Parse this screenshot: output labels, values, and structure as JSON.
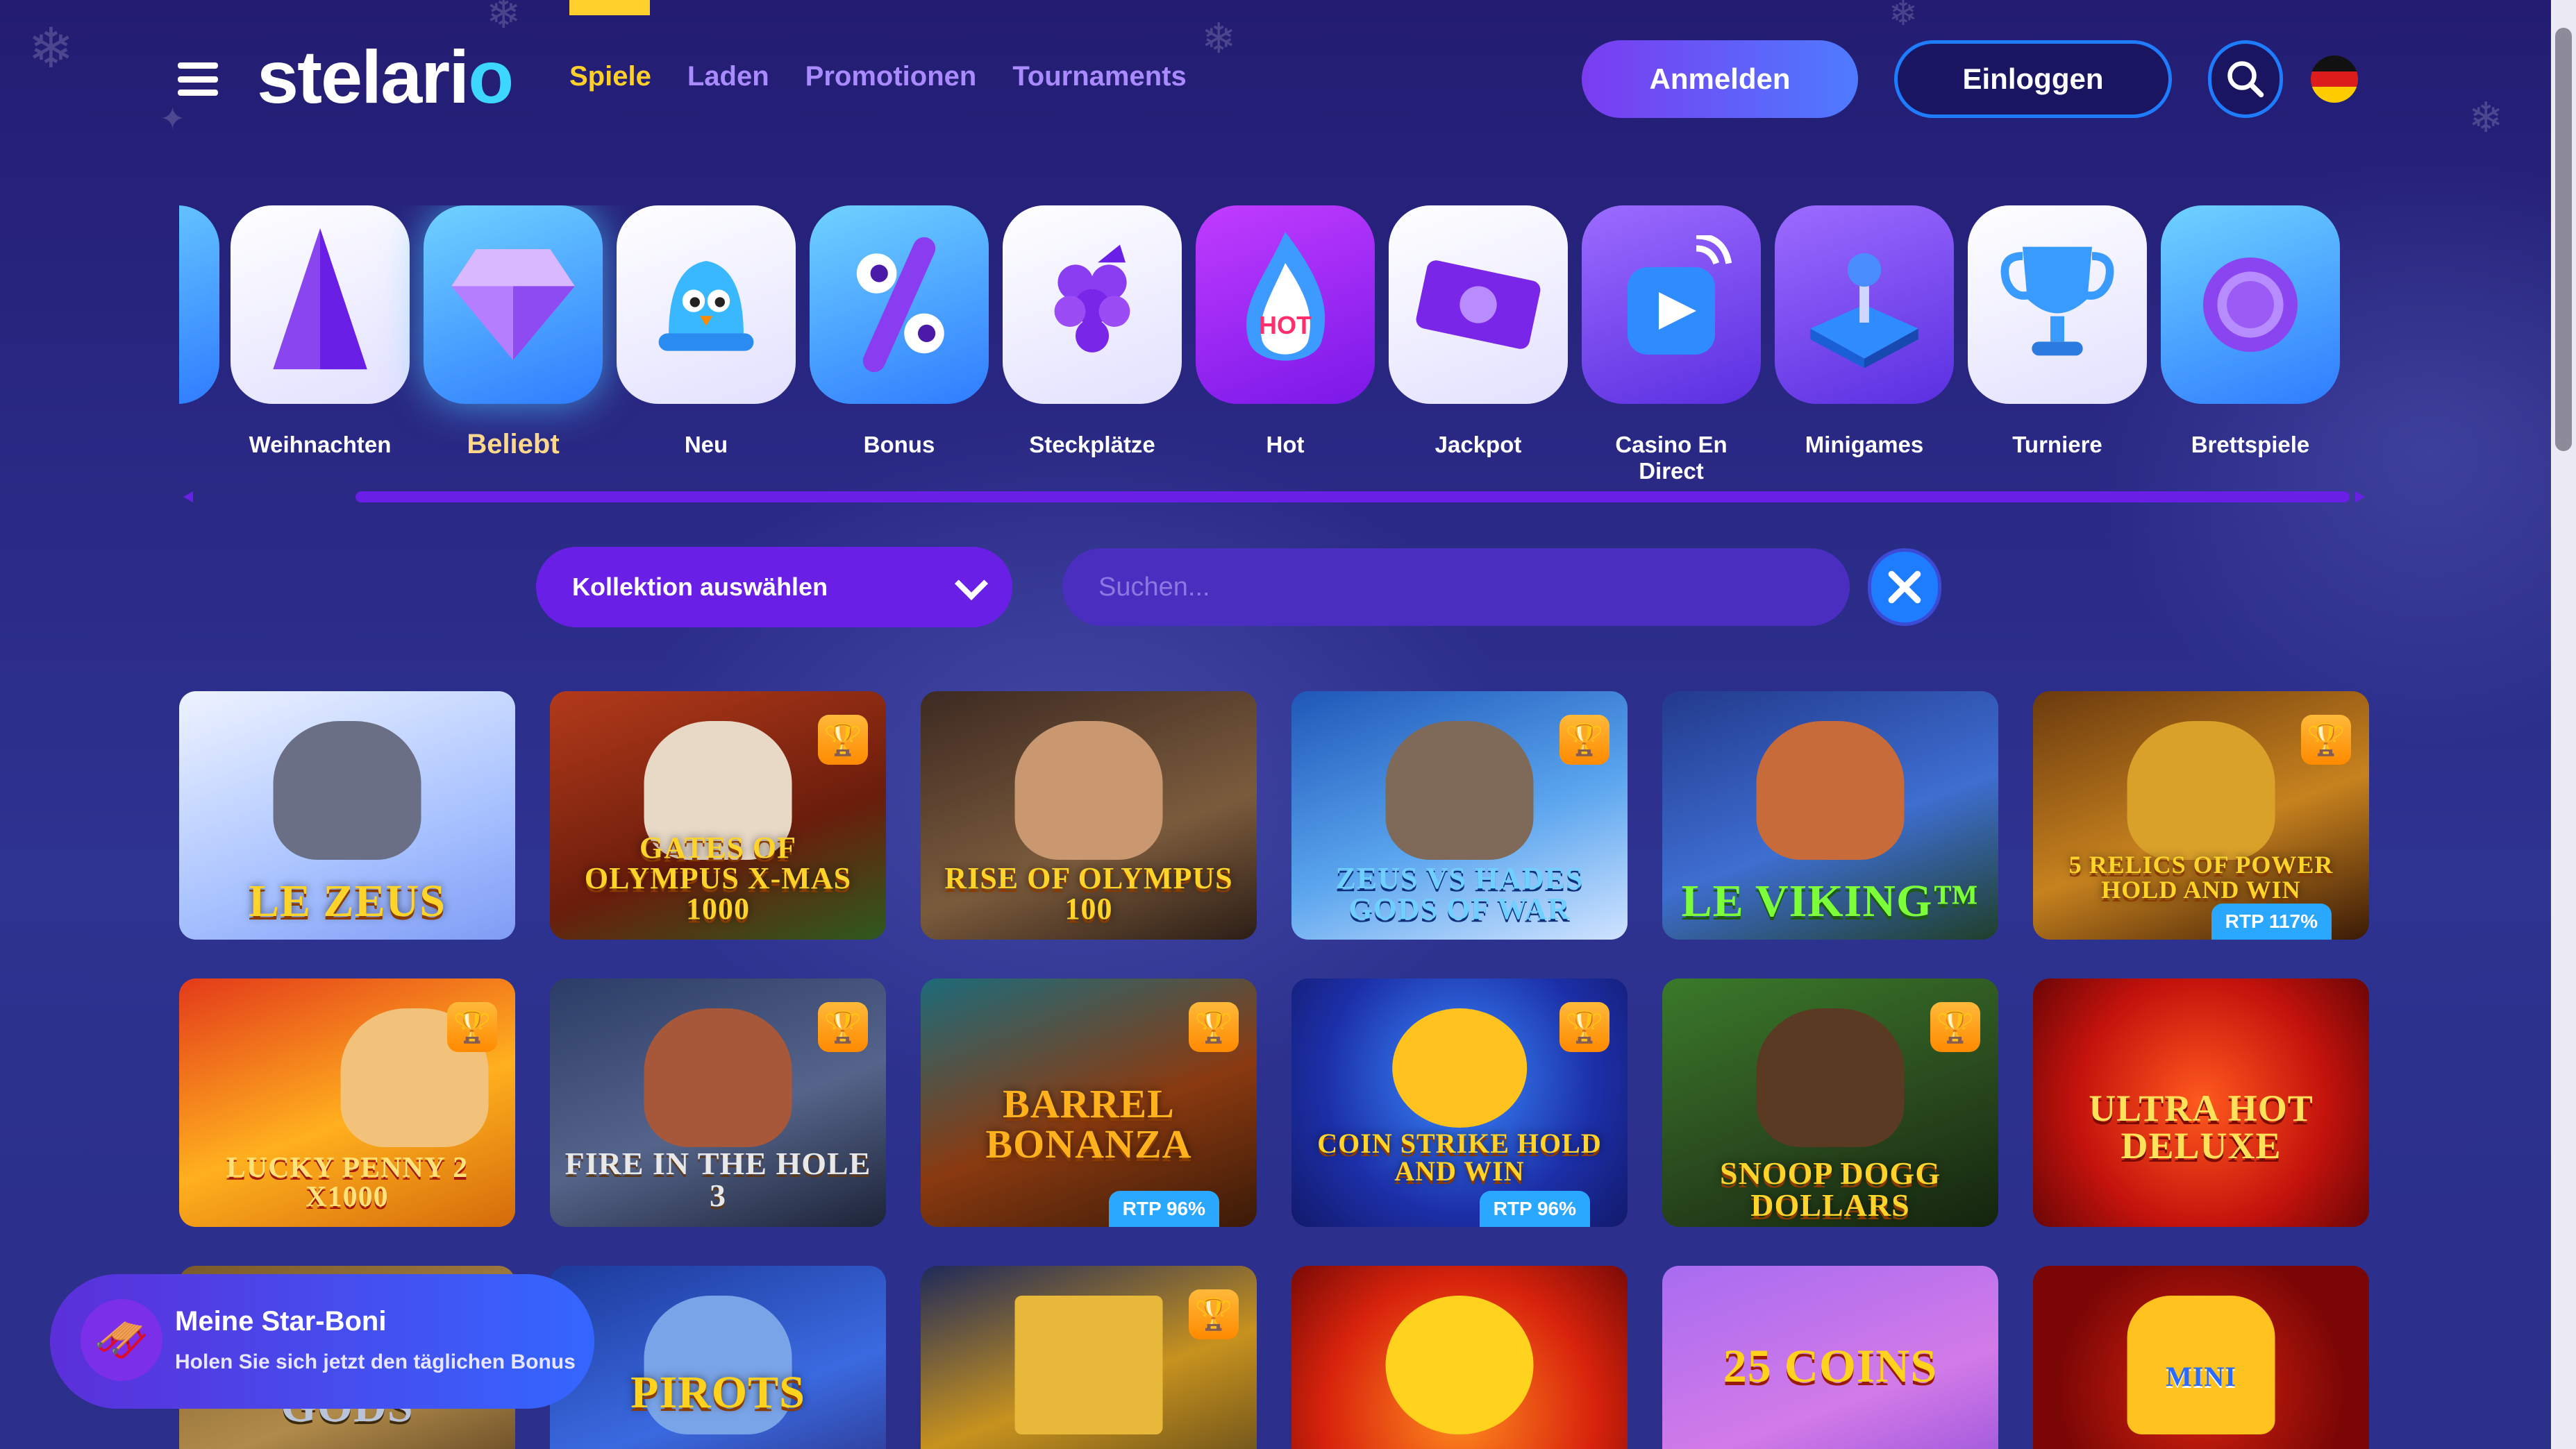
{
  "header": {
    "logo": "stelario",
    "nav": [
      {
        "label": "Spiele",
        "active": true
      },
      {
        "label": "Laden",
        "active": false
      },
      {
        "label": "Promotionen",
        "active": false
      },
      {
        "label": "Tournaments",
        "active": false
      }
    ],
    "register_label": "Anmelden",
    "login_label": "Einloggen",
    "language": "Deutsch",
    "search_icon": "search-icon",
    "menu_icon": "hamburger-menu-icon"
  },
  "categories": [
    {
      "label": "Weihnachten",
      "icon": "christmas-tree-icon",
      "active": false
    },
    {
      "label": "Beliebt",
      "icon": "diamond-icon",
      "active": true
    },
    {
      "label": "Neu",
      "icon": "bell-icon",
      "active": false
    },
    {
      "label": "Bonus",
      "icon": "percent-icon",
      "active": false
    },
    {
      "label": "Steckplätze",
      "icon": "grapes-icon",
      "active": false
    },
    {
      "label": "Hot",
      "icon": "flame-icon",
      "active": false
    },
    {
      "label": "Jackpot",
      "icon": "money-icon",
      "active": false
    },
    {
      "label": "Casino En Direct",
      "icon": "play-icon",
      "active": false
    },
    {
      "label": "Minigames",
      "icon": "joystick-icon",
      "active": false
    },
    {
      "label": "Turniere",
      "icon": "trophy-icon",
      "active": false
    },
    {
      "label": "Brettspiele",
      "icon": "chip-icon",
      "active": false
    }
  ],
  "filters": {
    "collection_label": "Kollektion auswählen",
    "search_placeholder": "Suchen..."
  },
  "games": [
    {
      "title": "LE ZEUS",
      "trophy": false,
      "rtp": ""
    },
    {
      "title": "GATES OF OLYMPUS X-MAS 1000",
      "trophy": true,
      "rtp": ""
    },
    {
      "title": "RISE OF OLYMPUS 100",
      "trophy": false,
      "rtp": ""
    },
    {
      "title": "ZEUS VS HADES GODS OF WAR",
      "trophy": true,
      "rtp": ""
    },
    {
      "title": "LE VIKING™",
      "trophy": false,
      "rtp": ""
    },
    {
      "title": "5 RELICS OF POWER HOLD AND WIN",
      "trophy": true,
      "rtp": "RTP 117%"
    },
    {
      "title": "LUCKY PENNY 2 X1000",
      "trophy": true,
      "rtp": ""
    },
    {
      "title": "FIRE IN THE HOLE 3",
      "trophy": true,
      "rtp": ""
    },
    {
      "title": "BARREL BONANZA",
      "trophy": true,
      "rtp": "RTP 96%"
    },
    {
      "title": "COIN STRIKE HOLD AND WIN",
      "trophy": true,
      "rtp": "RTP 96%"
    },
    {
      "title": "SNOOP DOGG DOLLARS",
      "trophy": true,
      "rtp": ""
    },
    {
      "title": "ULTRA HOT DELUXE",
      "trophy": false,
      "rtp": ""
    },
    {
      "title": "GODS",
      "trophy": false,
      "rtp": ""
    },
    {
      "title": "PIROTS",
      "trophy": false,
      "rtp": ""
    },
    {
      "title": "",
      "trophy": true,
      "rtp": ""
    },
    {
      "title": "",
      "trophy": false,
      "rtp": ""
    },
    {
      "title": "25 COINS",
      "trophy": false,
      "rtp": ""
    },
    {
      "title": "MINI",
      "trophy": false,
      "rtp": ""
    }
  ],
  "star_boni": {
    "title": "Meine Star-Boni",
    "subtitle": "Holen Sie sich jetzt den täglichen Bonus"
  },
  "colors": {
    "accent_yellow": "#ffcf2a",
    "nav_purple": "#a98bff",
    "primary_violet": "#6a1fe6",
    "primary_blue": "#1e7cff",
    "background": "#25217a"
  }
}
